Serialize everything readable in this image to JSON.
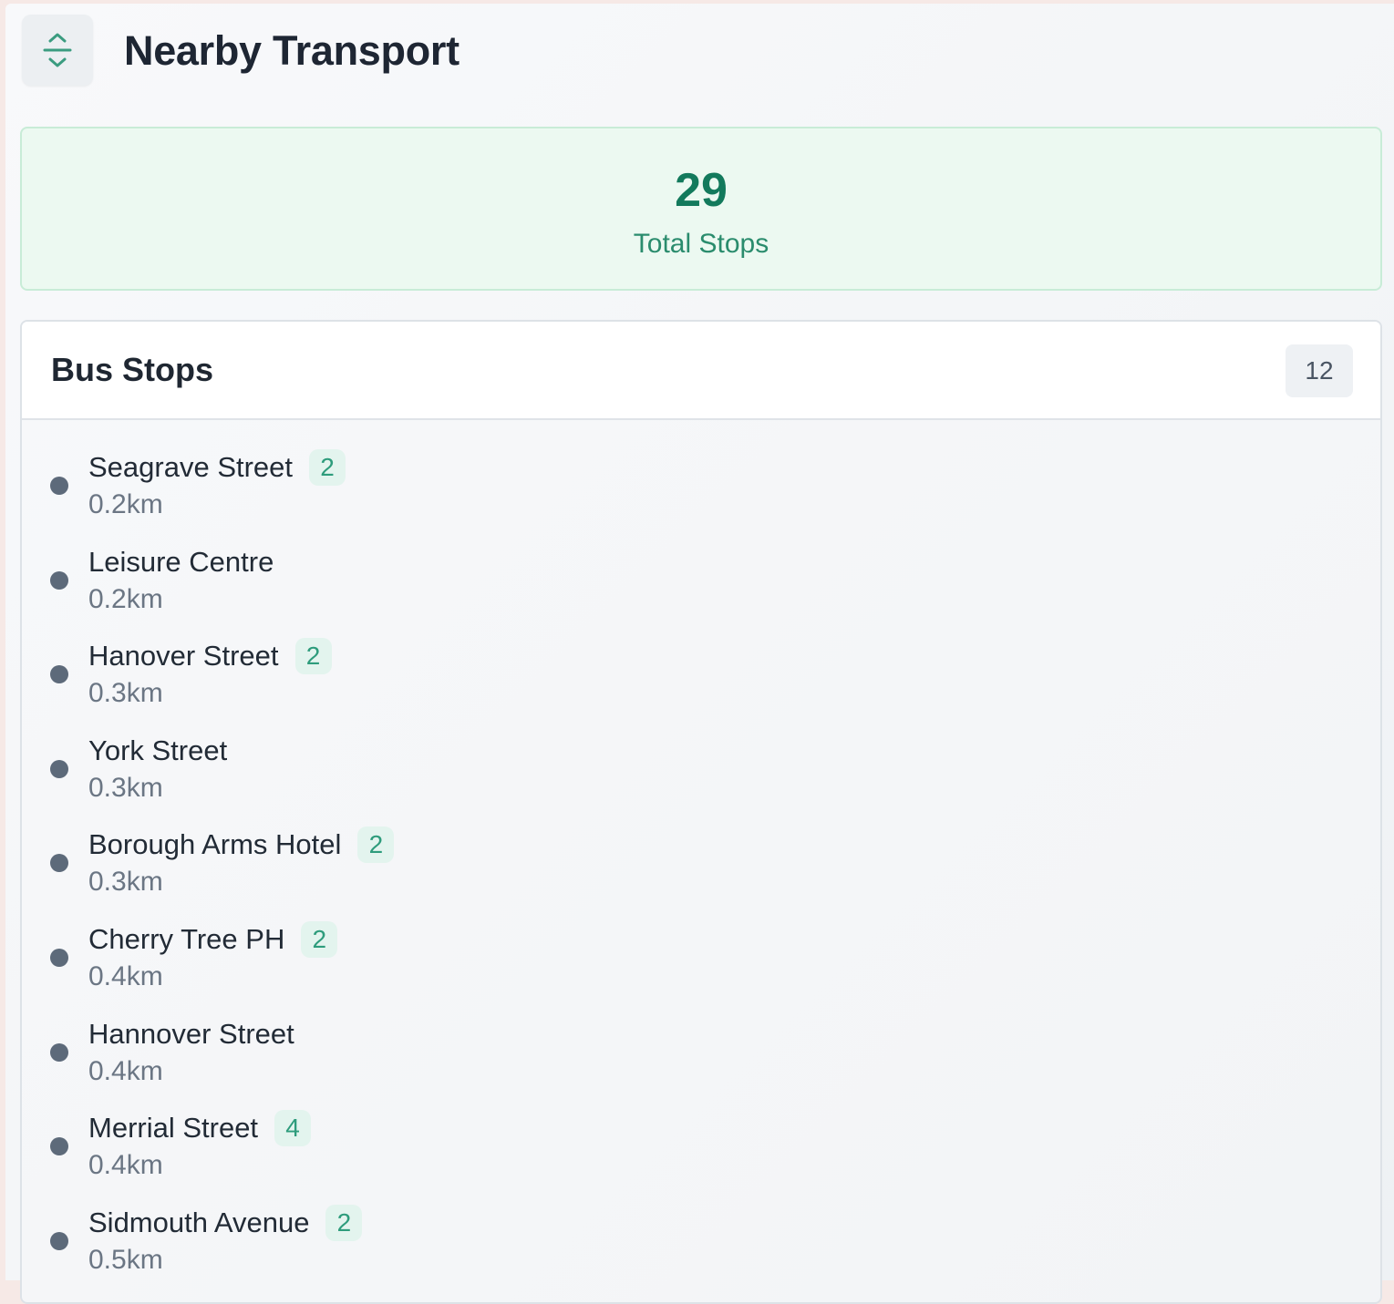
{
  "header": {
    "title": "Nearby Transport",
    "icon": "collapse-expand-icon"
  },
  "summary": {
    "total_value": "29",
    "total_label": "Total Stops"
  },
  "bus_stops": {
    "title": "Bus Stops",
    "count": "12",
    "items": [
      {
        "name": "Seagrave Street",
        "badge": "2",
        "distance": "0.2km"
      },
      {
        "name": "Leisure Centre",
        "badge": "",
        "distance": "0.2km"
      },
      {
        "name": "Hanover Street",
        "badge": "2",
        "distance": "0.3km"
      },
      {
        "name": "York Street",
        "badge": "",
        "distance": "0.3km"
      },
      {
        "name": "Borough Arms Hotel",
        "badge": "2",
        "distance": "0.3km"
      },
      {
        "name": "Cherry Tree PH",
        "badge": "2",
        "distance": "0.4km"
      },
      {
        "name": "Hannover Street",
        "badge": "",
        "distance": "0.4km"
      },
      {
        "name": "Merrial Street",
        "badge": "4",
        "distance": "0.4km"
      },
      {
        "name": "Sidmouth Avenue",
        "badge": "2",
        "distance": "0.5km"
      }
    ]
  },
  "colors": {
    "accent_green": "#137a5c",
    "summary_bg": "#ecf9f1",
    "dot": "#5d6a7a"
  }
}
